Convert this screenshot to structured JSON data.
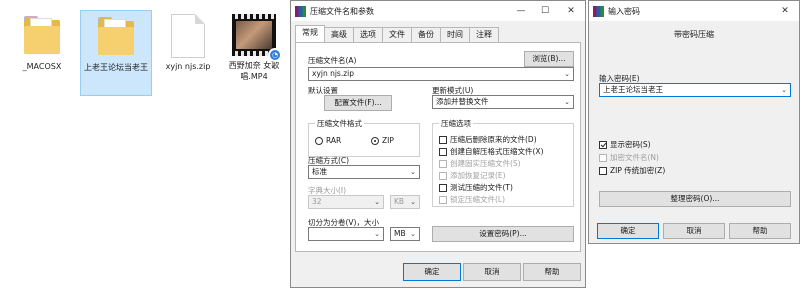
{
  "desktop": {
    "files": [
      {
        "name": "_MACOSX",
        "type": "folder"
      },
      {
        "name": "上老王论坛当老王",
        "type": "folder"
      },
      {
        "name": "xyjn njs.zip",
        "type": "file"
      },
      {
        "name": "西野加奈 女歌唱.MP4",
        "type": "video"
      }
    ]
  },
  "archive_dialog": {
    "title": "压缩文件名和参数",
    "controls": {
      "minimize": "—",
      "maximize": "☐",
      "close": "✕"
    },
    "tabs": [
      "常规",
      "高级",
      "选项",
      "文件",
      "备份",
      "时间",
      "注释"
    ],
    "archive_name_label": "压缩文件名(A)",
    "browse_button": "浏览(B)...",
    "archive_name_value": "xyjn njs.zip",
    "default_settings_label": "默认设置",
    "profiles_button": "配置文件(F)...",
    "update_mode_label": "更新模式(U)",
    "update_mode_value": "添加并替换文件",
    "format_group": "压缩文件格式",
    "format_options": [
      "RAR",
      "ZIP"
    ],
    "format_selected": "ZIP",
    "options_group": "压缩选项",
    "options": [
      {
        "label": "压缩后删除原来的文件(D)",
        "checked": false,
        "enabled": true
      },
      {
        "label": "创建自解压格式压缩文件(X)",
        "checked": false,
        "enabled": true
      },
      {
        "label": "创建固实压缩文件(S)",
        "checked": false,
        "enabled": false
      },
      {
        "label": "添加恢复记录(E)",
        "checked": false,
        "enabled": false
      },
      {
        "label": "测试压缩的文件(T)",
        "checked": false,
        "enabled": true
      },
      {
        "label": "锁定压缩文件(L)",
        "checked": false,
        "enabled": false
      }
    ],
    "method_label": "压缩方式(C)",
    "method_value": "标准",
    "dict_label": "字典大小(I)",
    "dict_value": "32",
    "dict_unit": "KB",
    "split_label": "切分为分卷(V)，大小",
    "split_value": "",
    "split_unit": "MB",
    "set_password_button": "设置密码(P)...",
    "ok_button": "确定",
    "cancel_button": "取消",
    "help_button": "帮助"
  },
  "password_dialog": {
    "title": "输入密码",
    "close": "✕",
    "heading": "带密码压缩",
    "password_label": "输入密码(E)",
    "password_value": "上老王论坛当老王",
    "options": [
      {
        "label": "显示密码(S)",
        "checked": true,
        "enabled": true
      },
      {
        "label": "加密文件名(N)",
        "checked": false,
        "enabled": false
      },
      {
        "label": "ZIP 传统加密(Z)",
        "checked": false,
        "enabled": true
      }
    ],
    "organize_button": "整理密码(O)...",
    "ok_button": "确定",
    "cancel_button": "取消",
    "help_button": "帮助"
  }
}
